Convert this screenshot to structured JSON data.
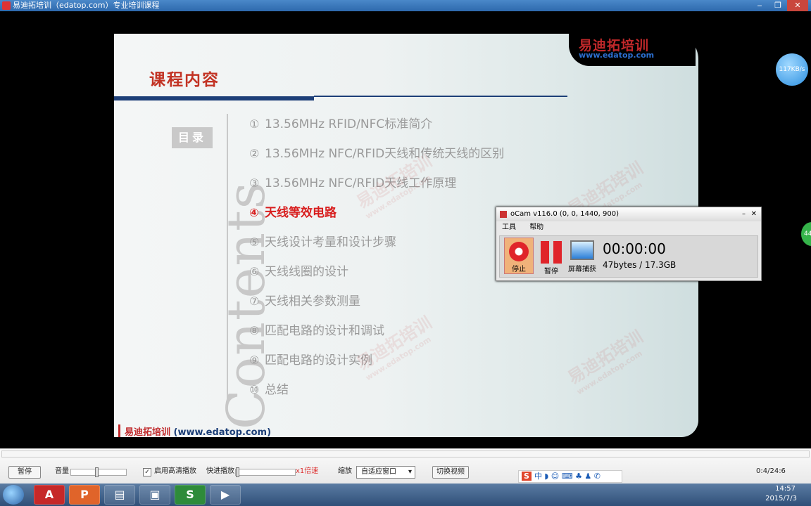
{
  "window": {
    "title": "易迪拓培训（edatop.com）专业培训课程",
    "min": "‒",
    "max": "❐",
    "close": "✕"
  },
  "slide": {
    "title": "课程内容",
    "mulu": "目录",
    "contents_word": "Contents",
    "logo_cn": "易迪拓培训",
    "logo_url": "www.edatop.com",
    "footer_cn": "易迪拓培训",
    "footer_url": "(www.edatop.com)",
    "toc": [
      {
        "num": "①",
        "text": "13.56MHz RFID/NFC标准简介"
      },
      {
        "num": "②",
        "text": "13.56MHz NFC/RFID天线和传统天线的区别"
      },
      {
        "num": "③",
        "text": "13.56MHz NFC/RFID天线工作原理"
      },
      {
        "num": "④",
        "text": "天线等效电路"
      },
      {
        "num": "⑤",
        "text": "天线设计考量和设计步骤"
      },
      {
        "num": "⑥",
        "text": "天线线圈的设计"
      },
      {
        "num": "⑦",
        "text": "天线相关参数测量"
      },
      {
        "num": "⑧",
        "text": "匹配电路的设计和调试"
      },
      {
        "num": "⑨",
        "text": "匹配电路的设计实例"
      },
      {
        "num": "⑩",
        "text": "总结"
      }
    ]
  },
  "overlay": {
    "speed": "117KB/s",
    "bubble": "44"
  },
  "ocam": {
    "title": "oCam v116.0 (0, 0, 1440, 900)",
    "menu": [
      "工具",
      "帮助"
    ],
    "stop": "停止",
    "pause": "暂停",
    "capture": "屏幕捕获",
    "time": "00:00:00",
    "size": "47bytes / 17.3GB"
  },
  "controls": {
    "pause": "暂停",
    "volume": "音量",
    "hq_check": "✓",
    "hq": "启用高清播放",
    "fast_forward": "快进播放",
    "rate": "x1倍速",
    "zoom": "缩放",
    "zoom_value": "自适应窗口",
    "switch": "切换视频",
    "time": "0:4/24:6"
  },
  "ime": {
    "logo": "S",
    "text": "中 ◗ ☺ ⌨ ♣ ♟ ✆"
  },
  "taskbar": {
    "apps": [
      "A",
      "P",
      "▤",
      "▣",
      "S",
      "▶"
    ],
    "time": "14:57",
    "date": "2015/7/3"
  }
}
